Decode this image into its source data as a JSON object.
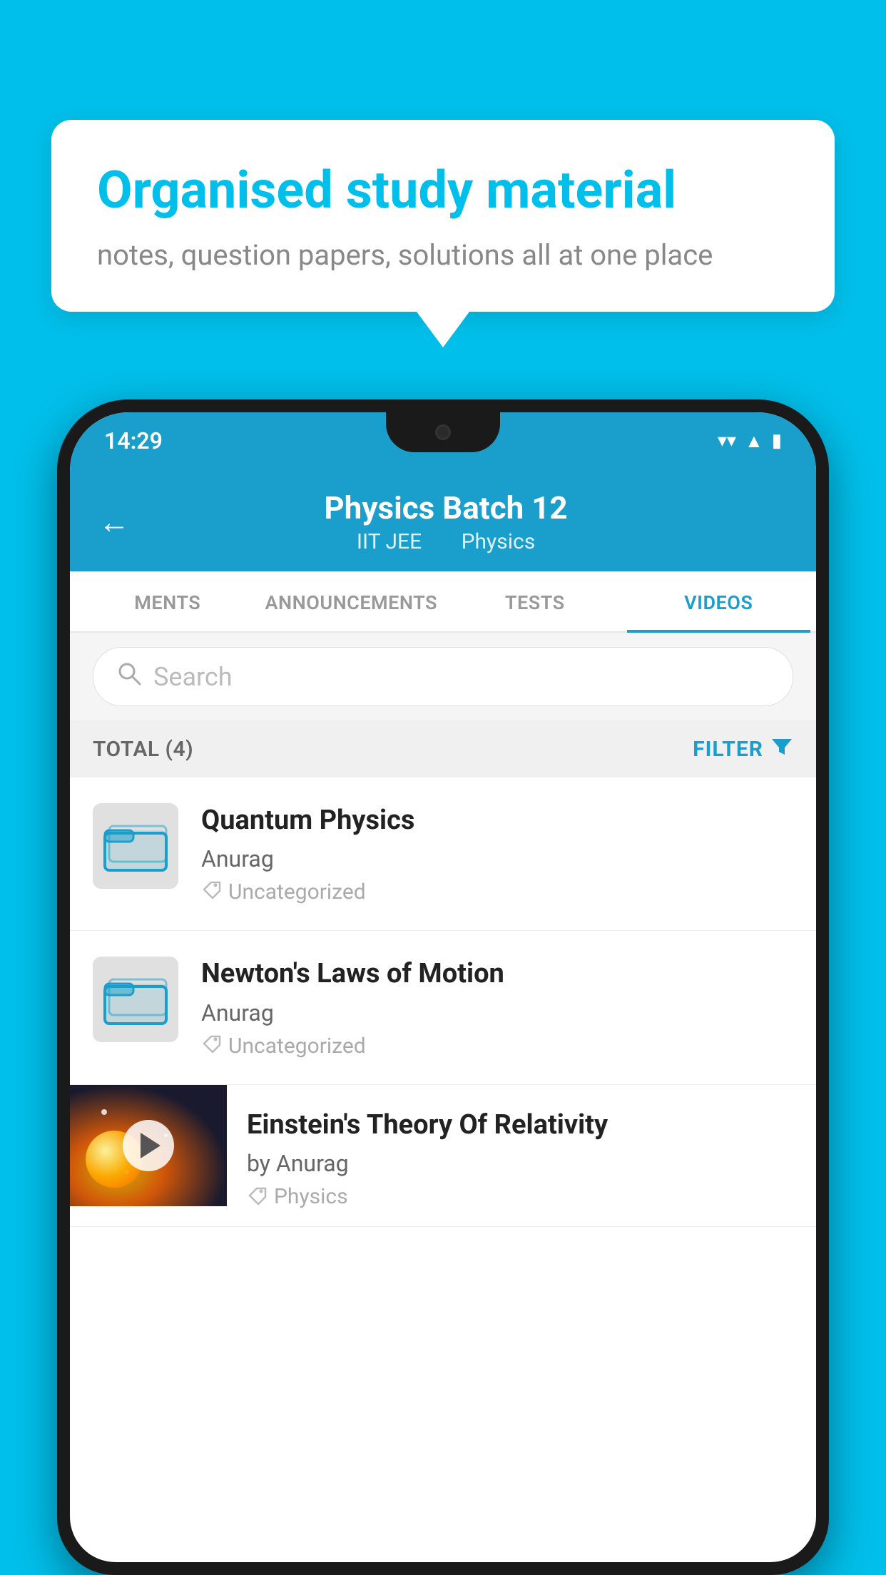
{
  "background_color": "#00BFEA",
  "speech_bubble": {
    "title": "Organised study material",
    "subtitle": "notes, question papers, solutions all at one place"
  },
  "status_bar": {
    "time": "14:29",
    "icons": [
      "wifi",
      "signal",
      "battery"
    ]
  },
  "app_header": {
    "title": "Physics Batch 12",
    "subtitle_part1": "IIT JEE",
    "subtitle_part2": "Physics",
    "back_label": "←"
  },
  "tabs": [
    {
      "label": "MENTS",
      "active": false
    },
    {
      "label": "ANNOUNCEMENTS",
      "active": false
    },
    {
      "label": "TESTS",
      "active": false
    },
    {
      "label": "VIDEOS",
      "active": true
    }
  ],
  "search": {
    "placeholder": "Search"
  },
  "filter_row": {
    "total_label": "TOTAL (4)",
    "filter_label": "FILTER"
  },
  "videos": [
    {
      "title": "Quantum Physics",
      "author": "Anurag",
      "tag": "Uncategorized",
      "type": "folder",
      "has_thumb": false
    },
    {
      "title": "Newton's Laws of Motion",
      "author": "Anurag",
      "tag": "Uncategorized",
      "type": "folder",
      "has_thumb": false
    },
    {
      "title": "Einstein's Theory Of Relativity",
      "author": "by Anurag",
      "tag": "Physics",
      "type": "video",
      "has_thumb": true
    }
  ]
}
